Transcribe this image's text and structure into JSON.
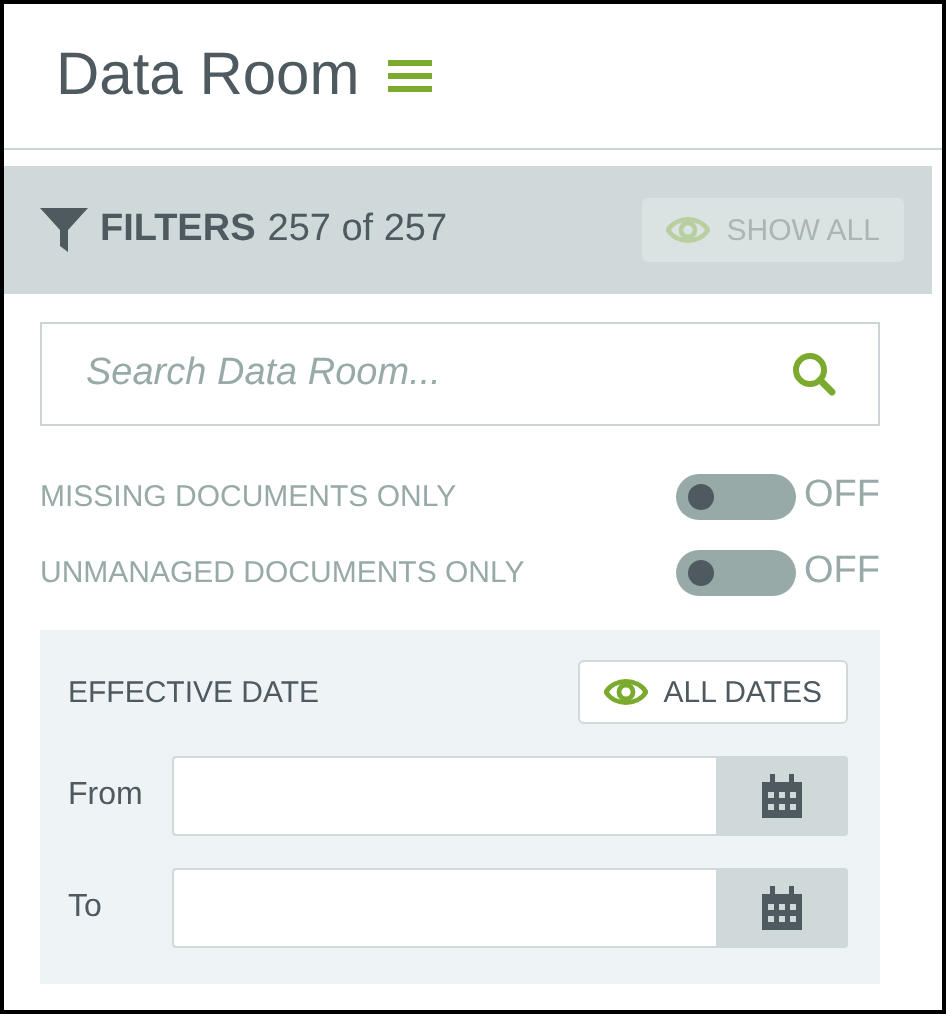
{
  "header": {
    "title": "Data Room"
  },
  "filters": {
    "label": "FILTERS",
    "count": "257 of 257",
    "show_all": {
      "label": "SHOW ALL",
      "disabled": true
    }
  },
  "search": {
    "placeholder": "Search Data Room..."
  },
  "toggles": [
    {
      "label": "MISSING DOCUMENTS ONLY",
      "on": false,
      "state": "OFF"
    },
    {
      "label": "UNMANAGED DOCUMENTS ONLY",
      "on": false,
      "state": "OFF"
    }
  ],
  "effective_date": {
    "label": "EFFECTIVE DATE",
    "all_dates": {
      "label": "ALL DATES",
      "disabled": false
    },
    "fields": [
      {
        "label": "From"
      },
      {
        "label": "To"
      }
    ]
  }
}
